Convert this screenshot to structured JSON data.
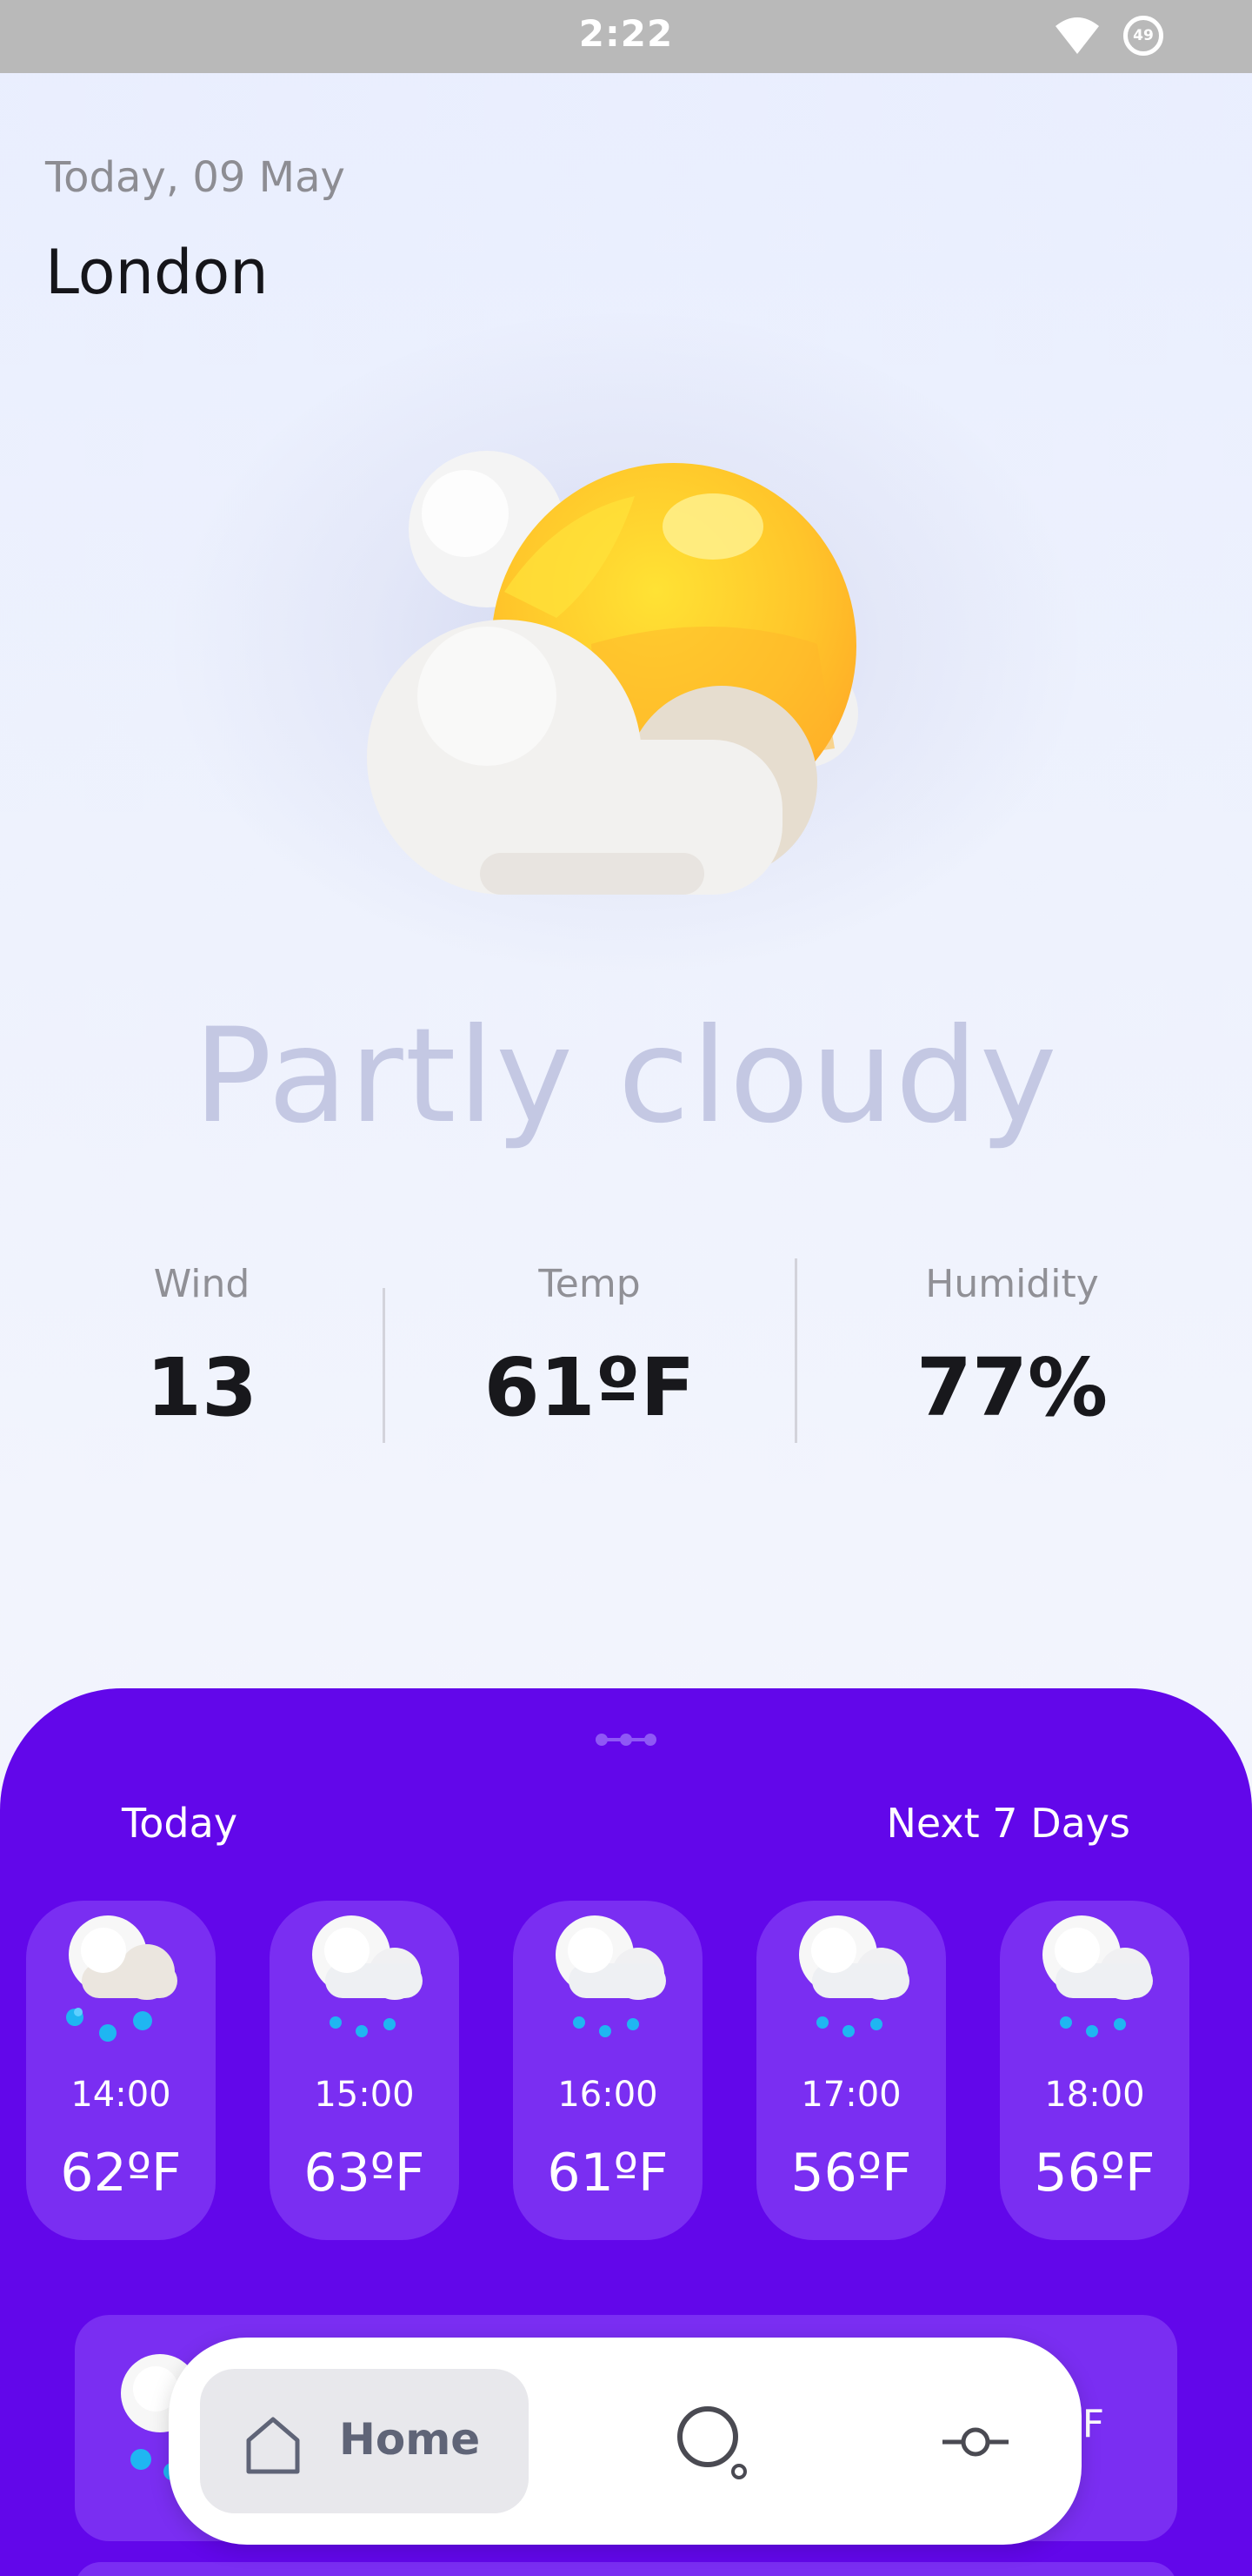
{
  "status_bar": {
    "time": "2:22",
    "battery": "49"
  },
  "header": {
    "date": "Today, 09 May",
    "city": "London"
  },
  "current": {
    "condition": "Partly cloudy",
    "icon": "sun-cloud-icon"
  },
  "stats": [
    {
      "label": "Wind",
      "value": "13"
    },
    {
      "label": "Temp",
      "value": "61ºF"
    },
    {
      "label": "Humidity",
      "value": "77%"
    }
  ],
  "forecast": {
    "tab_today": "Today",
    "tab_next": "Next 7 Days",
    "hourly": [
      {
        "time": "14:00",
        "temp": "62ºF",
        "icon": "rain-cloud-icon"
      },
      {
        "time": "15:00",
        "temp": "63ºF",
        "icon": "drizzle-cloud-icon"
      },
      {
        "time": "16:00",
        "temp": "61ºF",
        "icon": "drizzle-cloud-icon"
      },
      {
        "time": "17:00",
        "temp": "56ºF",
        "icon": "drizzle-cloud-icon"
      },
      {
        "time": "18:00",
        "temp": "56ºF",
        "icon": "drizzle-cloud-icon"
      }
    ],
    "daily_partial_temp": "6ºF"
  },
  "nav": {
    "home_label": "Home"
  },
  "colors": {
    "sheet": "#6207ea",
    "card": "#7a2ef2",
    "condition_text": "#c4c8e3"
  }
}
